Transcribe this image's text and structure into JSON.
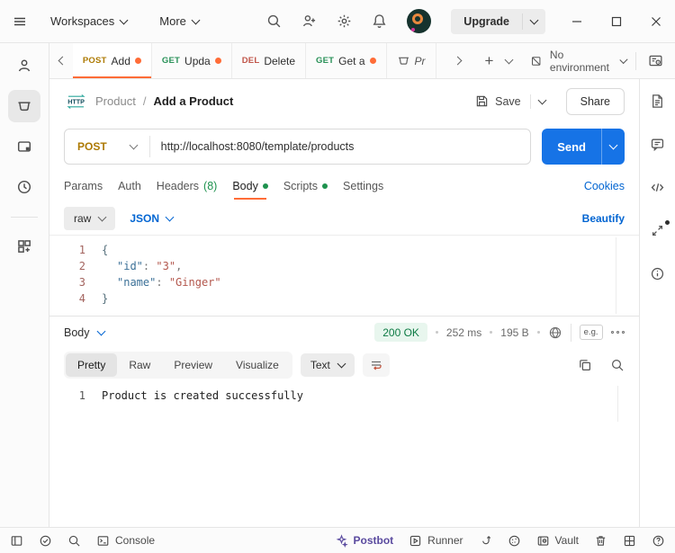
{
  "topbar": {
    "workspaces_label": "Workspaces",
    "more_label": "More",
    "upgrade_label": "Upgrade"
  },
  "tabbar": {
    "tabs": [
      {
        "method": "POST",
        "title": "Add"
      },
      {
        "method": "GET",
        "title": "Upda"
      },
      {
        "method": "DEL",
        "title": "Delete"
      },
      {
        "method": "GET",
        "title": "Get a"
      },
      {
        "method": "",
        "title": "Pr"
      }
    ],
    "environment_label": "No environment"
  },
  "header": {
    "collection_name": "Product",
    "separator": "/",
    "request_name": "Add a Product",
    "save_label": "Save",
    "share_label": "Share"
  },
  "request": {
    "method": "POST",
    "url": "http://localhost:8080/template/products",
    "send_label": "Send",
    "tabs": {
      "params": "Params",
      "auth": "Auth",
      "headers": "Headers",
      "headers_count": "(8)",
      "body": "Body",
      "scripts": "Scripts",
      "settings": "Settings"
    },
    "cookies_label": "Cookies",
    "body_type": "raw",
    "body_format": "JSON",
    "beautify_label": "Beautify",
    "editor": {
      "gutter": [
        "1",
        "2",
        "3",
        "4"
      ],
      "line1_open": "{",
      "line2_key": "\"id\"",
      "line2_colon": ":",
      "line2_value": "\"3\"",
      "line2_comma": ",",
      "line3_key": "\"name\"",
      "line3_colon": ":",
      "line3_value": "\"Ginger\"",
      "line4_close": "}"
    }
  },
  "response": {
    "body_label": "Body",
    "status": "200 OK",
    "time": "252 ms",
    "size": "195 B",
    "example_badge": "e.g.",
    "tabs": {
      "pretty": "Pretty",
      "raw": "Raw",
      "preview": "Preview",
      "visualize": "Visualize"
    },
    "format": "Text",
    "line_number": "1",
    "content": "Product is created successfully"
  },
  "statusbar": {
    "console_label": "Console",
    "postbot_label": "Postbot",
    "runner_label": "Runner",
    "vault_label": "Vault"
  },
  "colors": {
    "accent_orange": "#ff6c37",
    "method_post": "#ad7a03",
    "method_get": "#299158",
    "method_delete": "#c0564a",
    "link_blue": "#0265d2",
    "send_blue": "#1673e6",
    "status_green_text": "#0c7a43",
    "status_green_bg": "#e8f6ee",
    "postbot_purple": "#5a4a9f"
  }
}
